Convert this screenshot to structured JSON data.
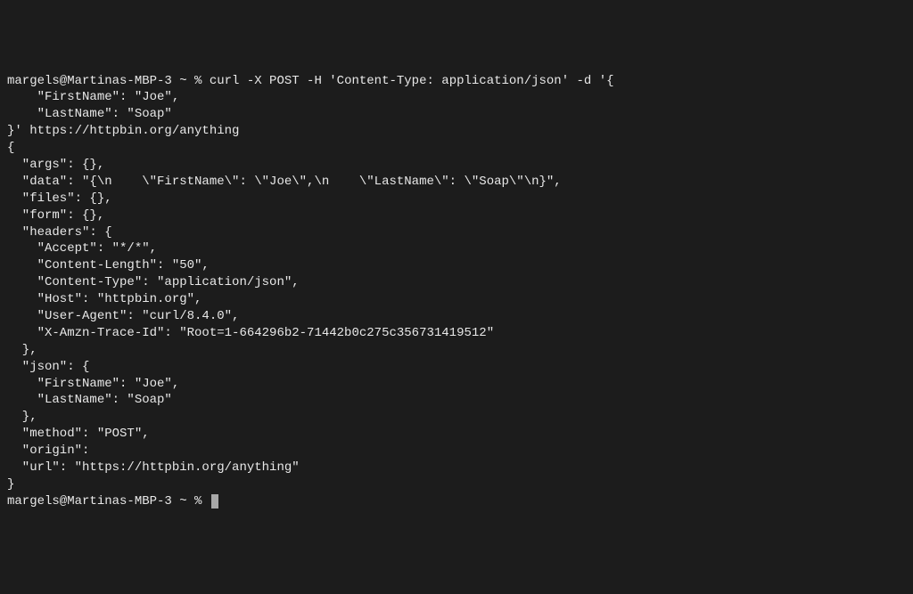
{
  "prompt1_user": "margels@Martinas-MBP-3 ~ % ",
  "cmd_line1": "curl -X POST -H 'Content-Type: application/json' -d '{",
  "cmd_line2": "    \"FirstName\": \"Joe\",",
  "cmd_line3": "    \"LastName\": \"Soap\"",
  "cmd_line4": "}' https://httpbin.org/anything",
  "out_line1": "{",
  "out_line2": "  \"args\": {},",
  "out_line3": "  \"data\": \"{\\n    \\\"FirstName\\\": \\\"Joe\\\",\\n    \\\"LastName\\\": \\\"Soap\\\"\\n}\",",
  "out_line4": "  \"files\": {},",
  "out_line5": "  \"form\": {},",
  "out_line6": "  \"headers\": {",
  "out_line7": "    \"Accept\": \"*/*\",",
  "out_line8": "    \"Content-Length\": \"50\",",
  "out_line9": "    \"Content-Type\": \"application/json\",",
  "out_line10": "    \"Host\": \"httpbin.org\",",
  "out_line11": "    \"User-Agent\": \"curl/8.4.0\",",
  "out_line12": "    \"X-Amzn-Trace-Id\": \"Root=1-664296b2-71442b0c275c356731419512\"",
  "out_line13": "  },",
  "out_line14": "  \"json\": {",
  "out_line15": "    \"FirstName\": \"Joe\",",
  "out_line16": "    \"LastName\": \"Soap\"",
  "out_line17": "  },",
  "out_line18": "  \"method\": \"POST\",",
  "out_line19": "  \"origin\":",
  "out_line20": "  \"url\": \"https://httpbin.org/anything\"",
  "out_line21": "}",
  "prompt2_user": "margels@Martinas-MBP-3 ~ % "
}
